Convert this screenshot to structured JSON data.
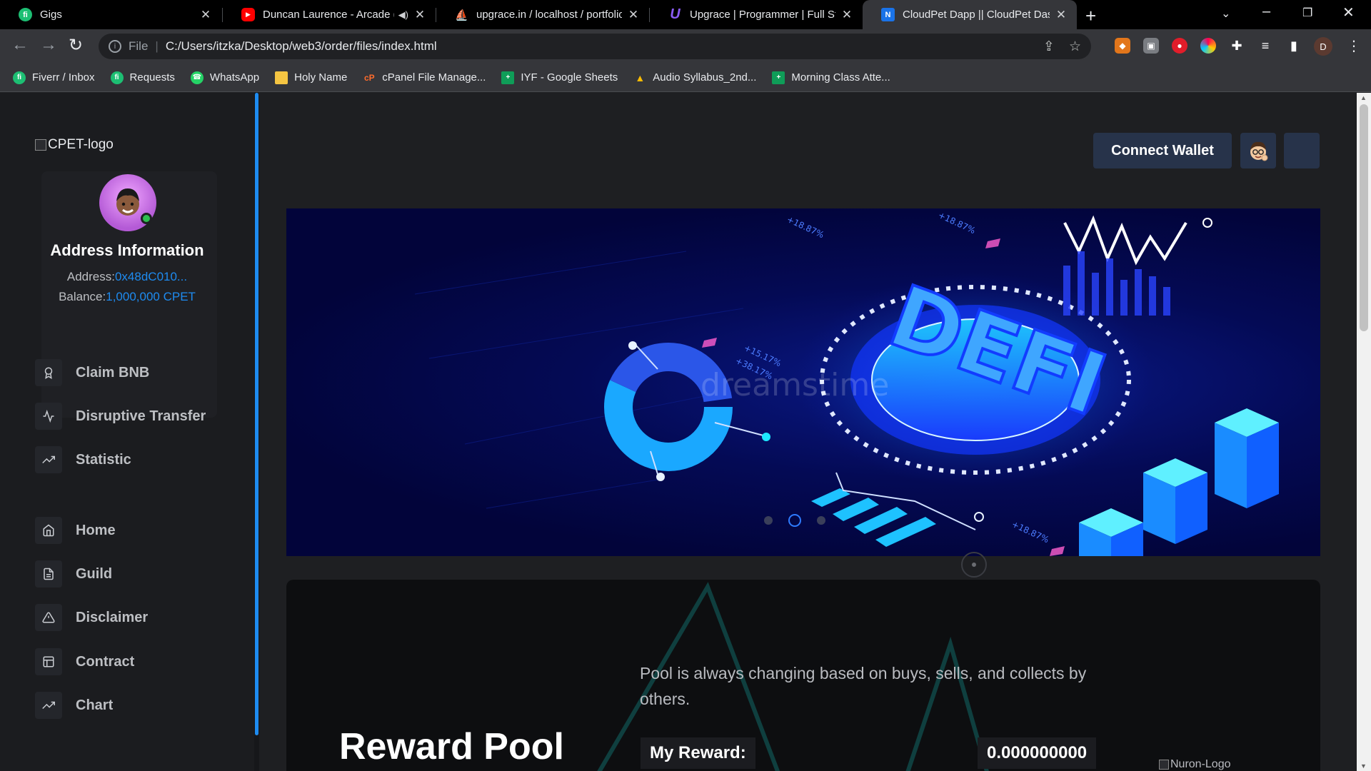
{
  "browser": {
    "tabs": [
      {
        "title": "Gigs",
        "icon_color": "#1dbf73",
        "icon_text": "fi",
        "active": false
      },
      {
        "title": "Duncan Laurence - Arcade (L",
        "icon_color": "#ff0000",
        "icon_text": "▶",
        "active": false,
        "muted": true
      },
      {
        "title": "upgrace.in / localhost / portfolio",
        "icon_color": "#f29111",
        "icon_text": "⛵",
        "active": false
      },
      {
        "title": "Upgrace | Programmer | Full Stac",
        "icon_color": "#6c3ce0",
        "icon_text": "U",
        "active": false
      },
      {
        "title": "CloudPet Dapp || CloudPet Dashb",
        "icon_color": "#1a73e8",
        "icon_text": "N",
        "active": true
      }
    ],
    "address": {
      "scheme": "File",
      "url": "C:/Users/itzka/Desktop/web3/order/files/index.html"
    },
    "profile_initial": "D",
    "bookmarks": [
      {
        "label": "Fiverr / Inbox",
        "icon_color": "#1dbf73",
        "icon_text": "fi"
      },
      {
        "label": "Requests",
        "icon_color": "#1dbf73",
        "icon_text": "fi"
      },
      {
        "label": "WhatsApp",
        "icon_color": "#25d366",
        "icon_text": "☎"
      },
      {
        "label": "Holy Name",
        "icon_color": "#f5c542",
        "icon_text": ""
      },
      {
        "label": "cPanel File Manage...",
        "icon_color": "#ff6c2c",
        "icon_text": "cP"
      },
      {
        "label": "IYF - Google Sheets",
        "icon_color": "#0f9d58",
        "icon_text": "+"
      },
      {
        "label": "Audio Syllabus_2nd...",
        "icon_color": "#fbbc04",
        "icon_text": "▲"
      },
      {
        "label": "Morning Class Atte...",
        "icon_color": "#0f9d58",
        "icon_text": "+"
      }
    ]
  },
  "sidebar": {
    "logo_alt": "CPET-logo",
    "address_title": "Address Information",
    "address_label": "Address:",
    "address_value": "0x48dC010...",
    "balance_label": "Balance:",
    "balance_value": "1,000,000 CPET",
    "menu": [
      {
        "label": "Claim BNB",
        "icon": "award-icon"
      },
      {
        "label": "Disruptive Transfer",
        "icon": "activity-icon"
      },
      {
        "label": "Statistic",
        "icon": "trending-up-icon"
      },
      {
        "label": "Home",
        "icon": "home-icon"
      },
      {
        "label": "Guild",
        "icon": "file-text-icon"
      },
      {
        "label": "Disclaimer",
        "icon": "alert-triangle-icon"
      },
      {
        "label": "Contract",
        "icon": "layout-icon"
      },
      {
        "label": "Chart",
        "icon": "trending-up-icon"
      }
    ]
  },
  "header": {
    "connect_wallet": "Connect Wallet"
  },
  "banner": {
    "main_text": "DEFI",
    "watermark": "dreamstime",
    "labels": [
      "+18.87%",
      "+18.87%",
      "+15.17%",
      "+38.17%",
      "+18.87%"
    ]
  },
  "reward": {
    "title": "Reward Pool",
    "description": "Pool is always changing based on buys, sells, and collects by others.",
    "my_reward_label": "My Reward:",
    "my_reward_value": "0.000000000",
    "partner_logo_alt": "Nuron-Logo"
  },
  "colors": {
    "accent": "#1e8bf0",
    "button_bg": "#27334a",
    "sidebar_bg": "#1b1c1f"
  }
}
